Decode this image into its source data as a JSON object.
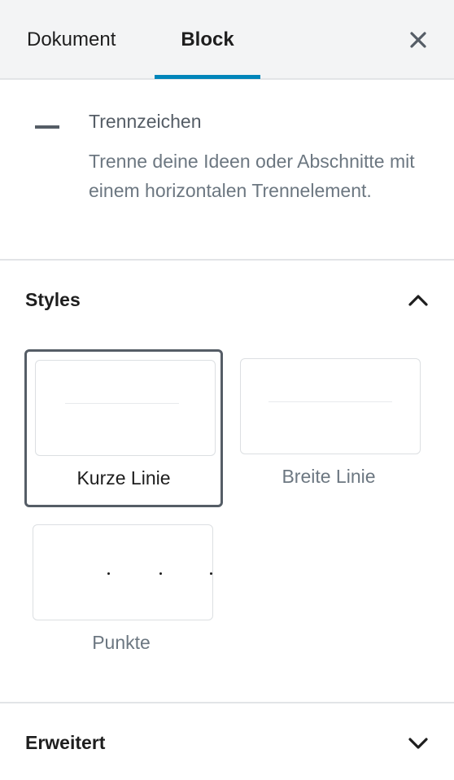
{
  "tabs": {
    "document_label": "Dokument",
    "block_label": "Block",
    "close_icon": "close-icon"
  },
  "block_card": {
    "icon": "separator-icon",
    "title": "Trennzeichen",
    "description": "Trenne deine Ideen oder Abschnitte mit einem horizontalen Trennelement."
  },
  "styles_panel": {
    "title": "Styles",
    "expanded": true,
    "toggle_icon": "chevron-up-icon",
    "options": [
      {
        "label": "Kurze Linie",
        "selected": true
      },
      {
        "label": "Breite Linie",
        "selected": false
      },
      {
        "label": "Punkte",
        "selected": false
      }
    ]
  },
  "advanced_panel": {
    "title": "Erweitert",
    "expanded": false,
    "toggle_icon": "chevron-down-icon"
  },
  "colors": {
    "accent": "#0085ba",
    "header_bg": "#f3f4f5",
    "border": "#e2e4e7",
    "selected_border": "#555d66",
    "muted_text": "#6c7781"
  }
}
